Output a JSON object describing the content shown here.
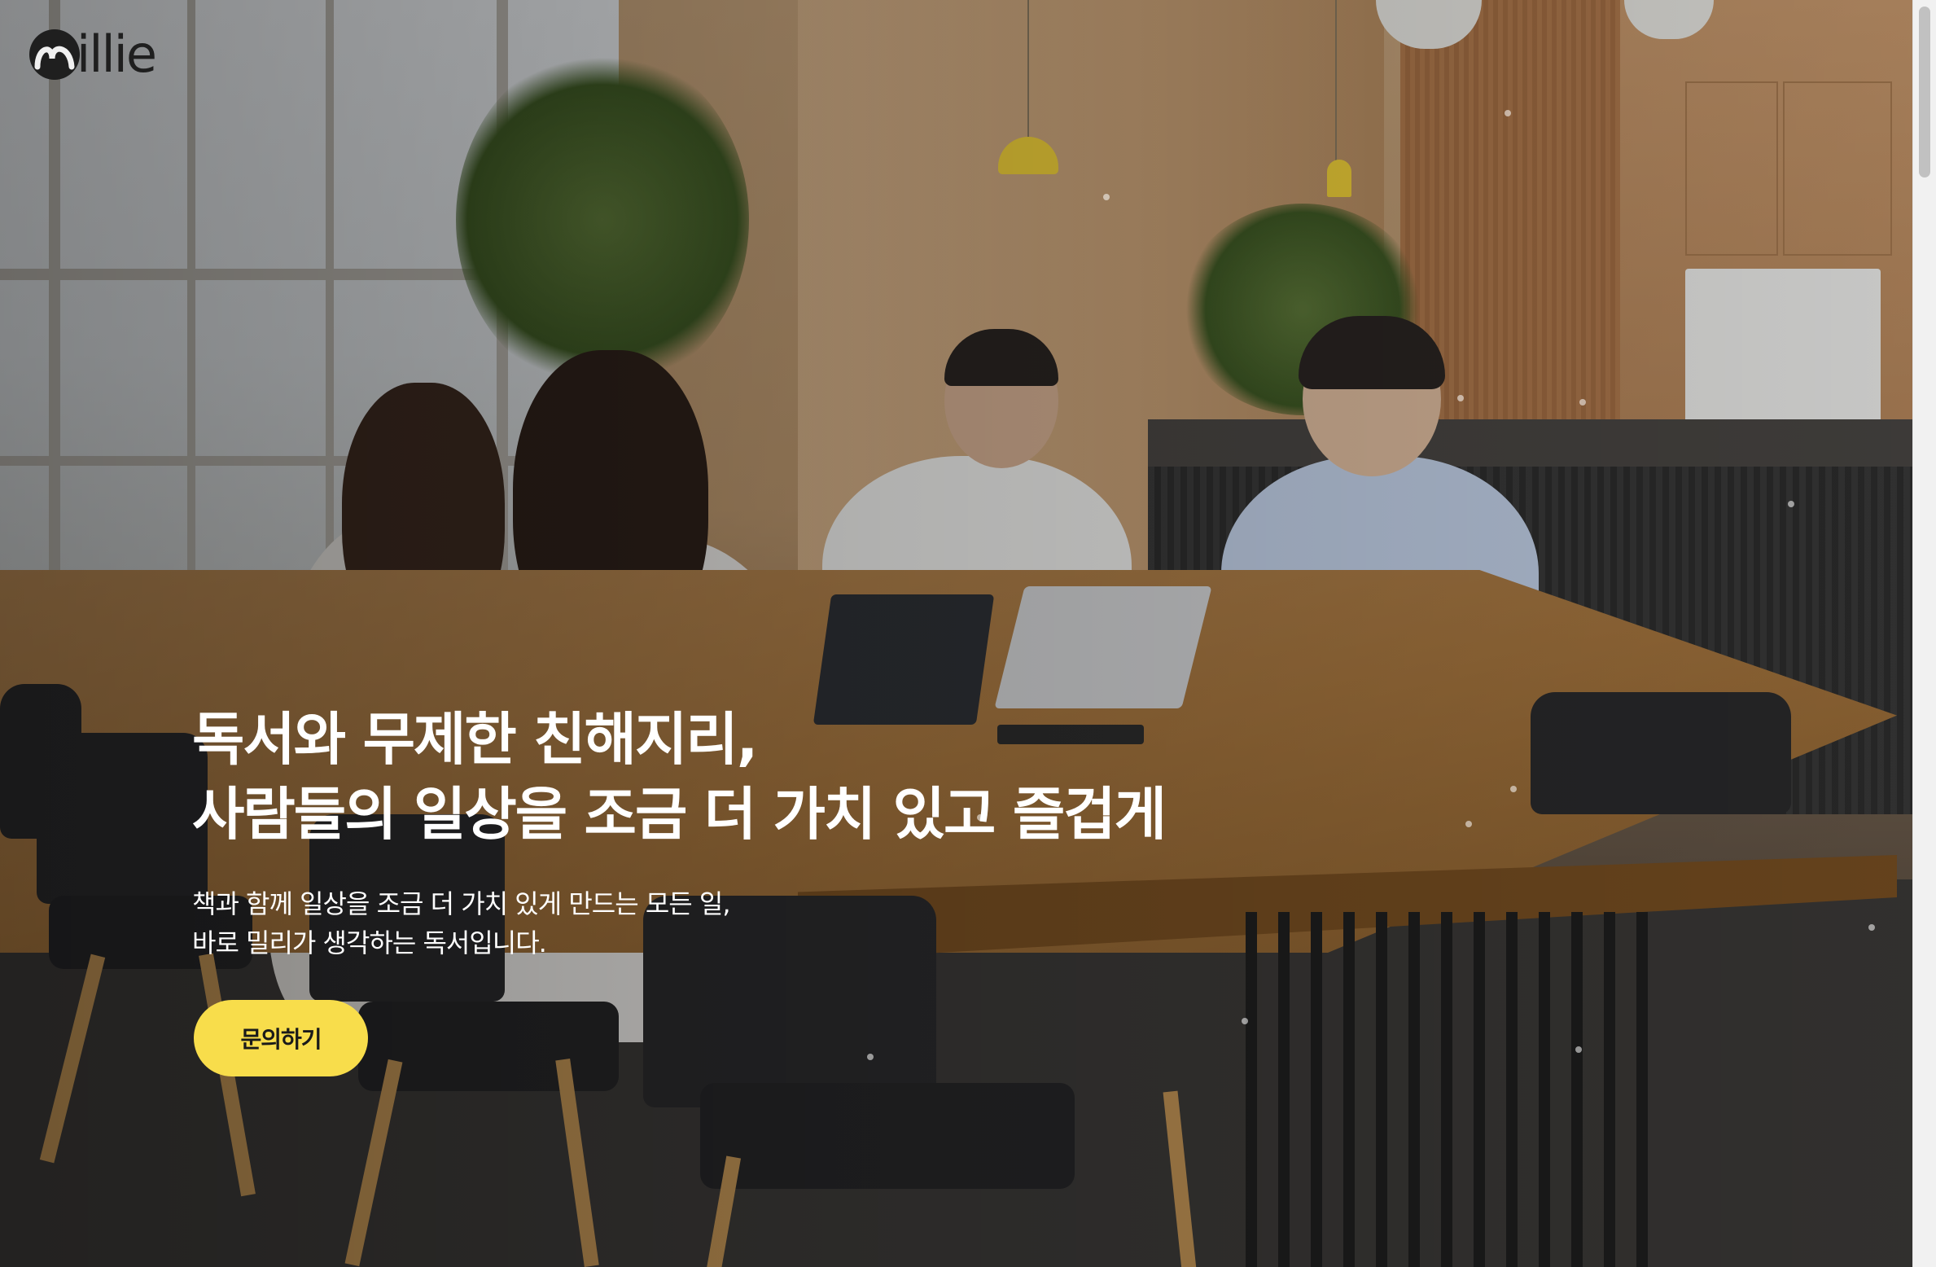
{
  "brand": {
    "logo_text": "illie",
    "logo_label": "millie"
  },
  "hero": {
    "title_line1": "독서와 무제한 친해지리,",
    "title_line2": "사람들의 일상을 조금 더 가치 있고 즐겁게",
    "subtitle_line1": "책과 함께 일상을 조금 더 가치 있게 만드는 모든 일,",
    "subtitle_line2": "바로 밀리가 생각하는 독서입니다.",
    "cta_label": "문의하기"
  },
  "colors": {
    "cta_background": "#f8dd4b",
    "logo": "#1f1f1f",
    "hero_text": "#ffffff"
  },
  "icons": {
    "logo_mark": "millie-m-icon"
  }
}
